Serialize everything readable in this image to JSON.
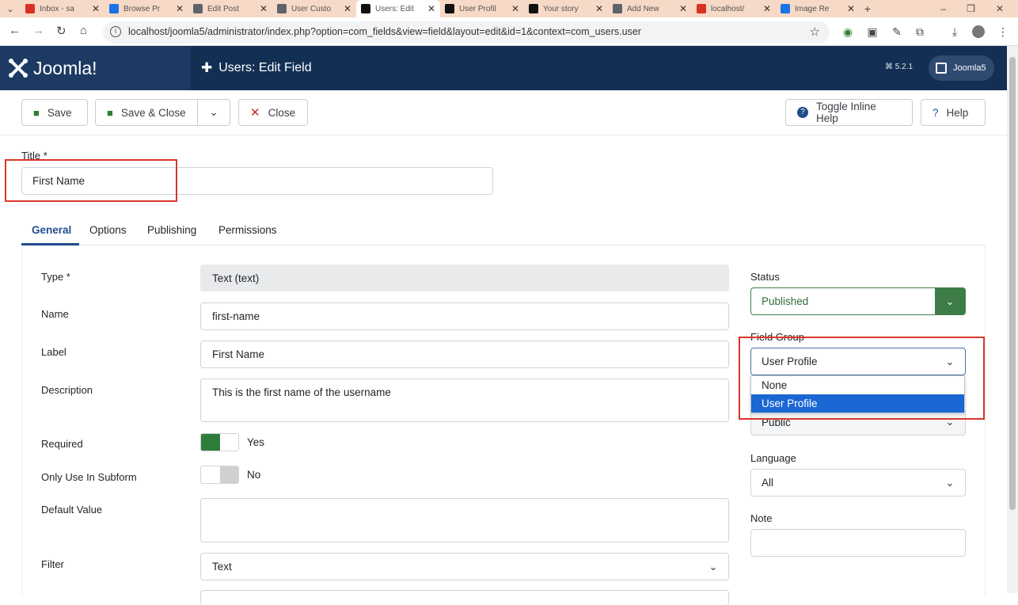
{
  "browser": {
    "tabs": [
      {
        "title": "Inbox - sa",
        "icon": "gmail-icon",
        "color": "#d93025"
      },
      {
        "title": "Browse Pr",
        "icon": "browse-icon",
        "color": "#1a73e8"
      },
      {
        "title": "Edit Post",
        "icon": "edit-post-icon",
        "color": "#5f6368"
      },
      {
        "title": "User Custo",
        "icon": "user-custom-icon",
        "color": "#5f6368"
      },
      {
        "title": "Users: Edit",
        "icon": "joomla-icon",
        "color": "#111111"
      },
      {
        "title": "User Profil",
        "icon": "joomla-icon",
        "color": "#111111"
      },
      {
        "title": "Your story",
        "icon": "medium-icon",
        "color": "#111111"
      },
      {
        "title": "Add New",
        "icon": "add-new-icon",
        "color": "#5f6368"
      },
      {
        "title": "localhost/",
        "icon": "localhost-icon",
        "color": "#d93025"
      },
      {
        "title": "Image Re",
        "icon": "image-icon",
        "color": "#1a73e8"
      }
    ],
    "url": "localhost/joomla5/administrator/index.php?option=com_fields&view=field&layout=edit&id=1&context=com_users.user"
  },
  "header": {
    "logo_text": "Joomla!",
    "page_title": "Users: Edit Field",
    "version": "5.2.1",
    "user_button": "Joomla5"
  },
  "toolbar": {
    "save": "Save",
    "save_close": "Save & Close",
    "close": "Close",
    "toggle_help": "Toggle Inline Help",
    "help": "Help"
  },
  "title_field": {
    "label": "Title *",
    "value": "First Name"
  },
  "form_tabs": [
    "General",
    "Options",
    "Publishing",
    "Permissions"
  ],
  "fields": {
    "type": {
      "label": "Type *",
      "value": "Text (text)"
    },
    "name": {
      "label": "Name",
      "value": "first-name"
    },
    "label": {
      "label": "Label",
      "value": "First Name"
    },
    "description": {
      "label": "Description",
      "value": "This is the first name of the username"
    },
    "required": {
      "label": "Required",
      "value": "Yes"
    },
    "subform": {
      "label": "Only Use In Subform",
      "value": "No"
    },
    "default_value": {
      "label": "Default Value",
      "value": ""
    },
    "filter": {
      "label": "Filter",
      "value": "Text"
    }
  },
  "sidebar": {
    "status": {
      "label": "Status",
      "value": "Published"
    },
    "field_group": {
      "label": "Field Group",
      "value": "User Profile",
      "options": [
        "None",
        "User Profile"
      ]
    },
    "access": {
      "value": "Public"
    },
    "language": {
      "label": "Language",
      "value": "All"
    },
    "note": {
      "label": "Note",
      "value": ""
    }
  },
  "colors": {
    "header": "#132f53",
    "accent": "#1f4e8c",
    "published_green": "#3e7d48",
    "highlight": "#d9372b"
  }
}
